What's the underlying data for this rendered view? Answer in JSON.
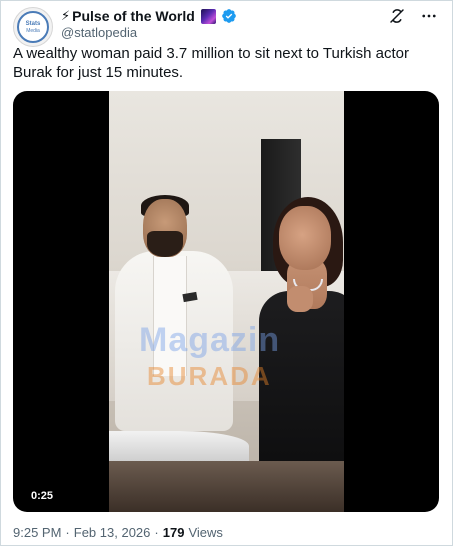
{
  "author": {
    "bolt": "⚡",
    "display_name": "Pulse of the World",
    "handle": "@statlopedia",
    "avatar_line1": "Stats",
    "avatar_line2": "Media",
    "verified_color": "#1d9bf0"
  },
  "tweet": {
    "text": "A wealthy woman paid 3.7 million to sit next to Turkish actor Burak for just 15 minutes."
  },
  "video": {
    "duration": "0:25",
    "watermark_top": "Magazin",
    "watermark_bottom": "BURADA"
  },
  "meta": {
    "time": "9:25 PM",
    "separator1": "·",
    "date": "Feb 13, 2026",
    "separator2": "·",
    "views_count": "179",
    "views_label": "Views"
  },
  "icons": {
    "grok": "grok-icon",
    "more": "more-icon"
  }
}
